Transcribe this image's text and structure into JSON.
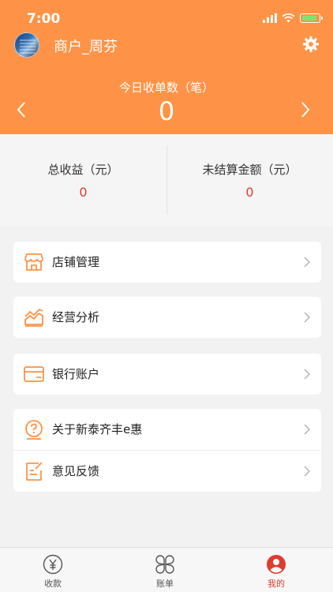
{
  "status_bar": {
    "time": "7:00"
  },
  "user": {
    "name": "商户_周芬"
  },
  "daily": {
    "title": "今日收单数（笔）",
    "value": "0"
  },
  "summary": {
    "total_income_label": "总收益（元）",
    "total_income_value": "0",
    "unsettled_label": "未结算金额（元）",
    "unsettled_value": "0"
  },
  "menu": {
    "store": "店铺管理",
    "analysis": "经营分析",
    "bank": "银行账户",
    "about": "关于新泰齐丰e惠",
    "feedback": "意见反馈"
  },
  "tabs": [
    {
      "label": "收款",
      "icon": "yuan-icon"
    },
    {
      "label": "账单",
      "icon": "clover-icon"
    },
    {
      "label": "我的",
      "icon": "user-icon"
    }
  ],
  "colors": {
    "accent": "#fe9347",
    "active": "#e23a2e",
    "value": "#e23a2e"
  },
  "active_tab": "我的"
}
